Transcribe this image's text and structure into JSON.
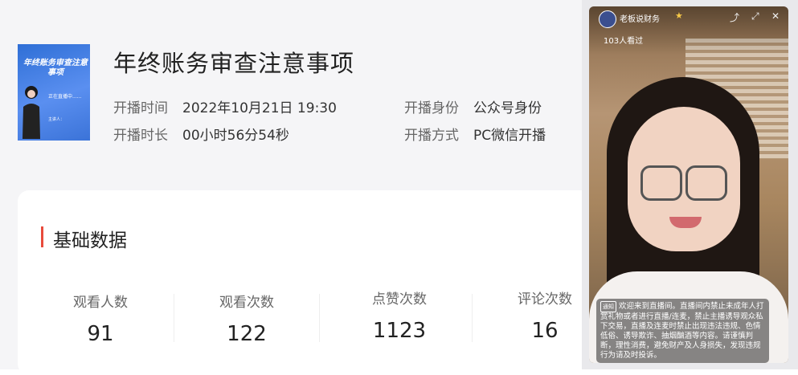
{
  "header": {
    "title": "年终账务审查注意事项",
    "cover_title": "年终账务审查注意事项",
    "cover_status": "正在直播中......",
    "cover_host": "主讲人：",
    "start_time_label": "开播时间",
    "start_time": "2022年10月21日 19:30",
    "duration_label": "开播时长",
    "duration": "00小时56分54秒",
    "identity_label": "开播身份",
    "identity": "公众号身份",
    "method_label": "开播方式",
    "method": "PC微信开播"
  },
  "section": {
    "title": "基础数据"
  },
  "stats": [
    {
      "label": "观看人数",
      "value": "91"
    },
    {
      "label": "观看次数",
      "value": "122"
    },
    {
      "label": "点赞次数",
      "value": "1123"
    },
    {
      "label": "评论次数",
      "value": "16"
    }
  ],
  "video": {
    "channel_name": "老板说财务",
    "viewers": "103人看过",
    "notice_tag": "通知",
    "notice": "欢迎来到直播间。直播间内禁止未成年人打赏礼物或者进行直播/连麦，禁止主播诱导观众私下交易，直播及连麦时禁止出现违法违规、色情低俗、诱导欺诈、抽烟酗酒等内容。请谨慎判断，理性消费，避免财产及人身损失，发现违规行为请及时投诉。",
    "icons": [
      "share-icon",
      "fullscreen-icon",
      "close-icon"
    ]
  },
  "colors": {
    "accent": "#e84b3c",
    "cover_blue": "#3b73d8"
  }
}
